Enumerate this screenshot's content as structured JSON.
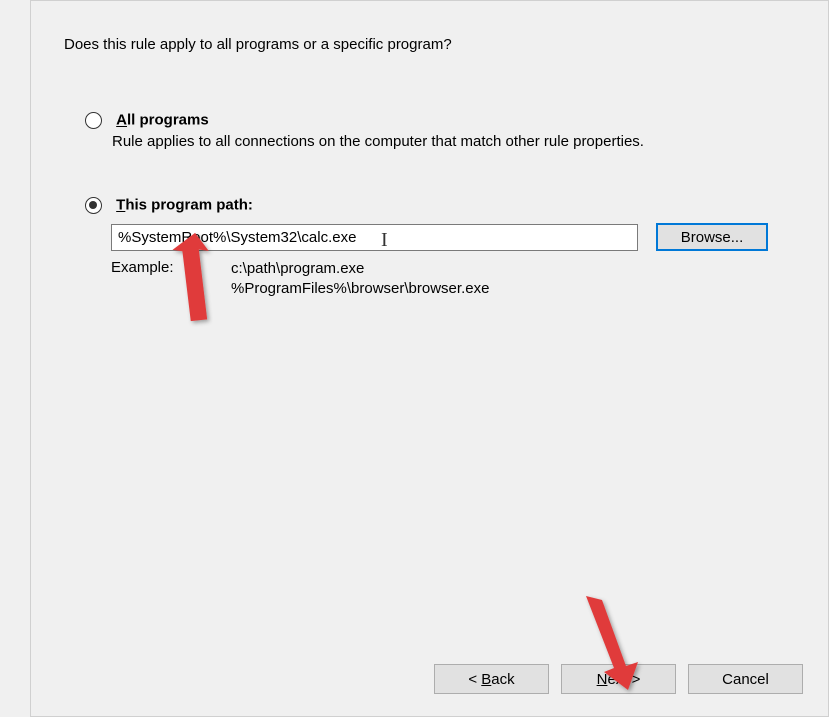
{
  "prompt": "Does this rule apply to all programs or a specific program?",
  "options": {
    "all": {
      "label_prefix": "A",
      "label_rest": "ll programs",
      "desc": "Rule applies to all connections on the computer that match other rule properties."
    },
    "this": {
      "label_prefix": "T",
      "label_rest": "his program path:"
    }
  },
  "path_input_value": "%SystemRoot%\\System32\\calc.exe",
  "browse_label": "Browse...",
  "example": {
    "label": "Example:",
    "line1": "c:\\path\\program.exe",
    "line2": "%ProgramFiles%\\browser\\browser.exe"
  },
  "footer": {
    "back_u": "B",
    "back_rest": "ack",
    "back_prefix": "< ",
    "next_u": "N",
    "next_rest": "ext >",
    "cancel": "Cancel"
  }
}
